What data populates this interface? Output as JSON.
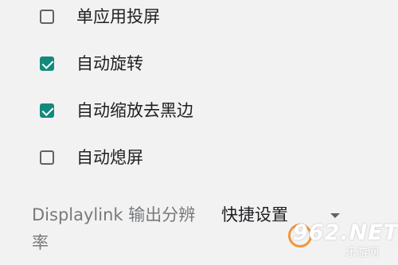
{
  "options": [
    {
      "label": "单应用投屏",
      "checked": false
    },
    {
      "label": "自动旋转",
      "checked": true
    },
    {
      "label": "自动缩放去黑边",
      "checked": true
    },
    {
      "label": "自动熄屏",
      "checked": false
    }
  ],
  "setting": {
    "label": "Displaylink 输出分辨率",
    "selected_value": "快捷设置"
  },
  "watermark": {
    "brand": "962.NET",
    "site": "乐游网"
  },
  "colors": {
    "checkbox_checked": "#138a7b",
    "checkbox_unchecked_border": "#5f6368",
    "background": "#f2f2f2",
    "secondary_text": "#77797c"
  },
  "icons": {
    "check": "checkmark-icon",
    "dropdown": "dropdown-arrow-icon"
  }
}
